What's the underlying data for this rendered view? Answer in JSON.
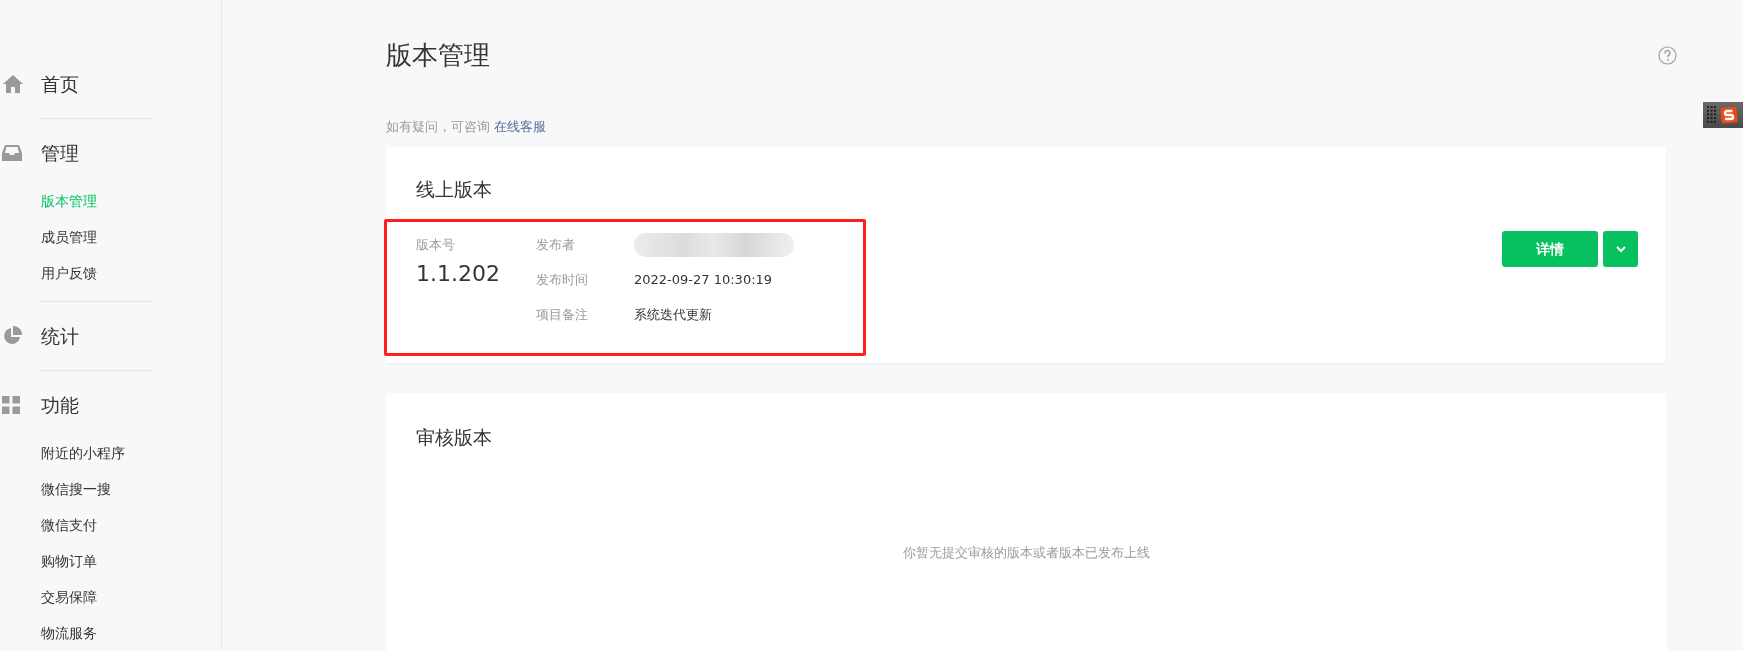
{
  "sidebar": {
    "sections": [
      {
        "label": "首页"
      },
      {
        "label": "管理",
        "items": [
          {
            "label": "版本管理",
            "selected": true
          },
          {
            "label": "成员管理",
            "selected": false
          },
          {
            "label": "用户反馈",
            "selected": false
          }
        ]
      },
      {
        "label": "统计"
      },
      {
        "label": "功能",
        "items": [
          {
            "label": "附近的小程序",
            "selected": false
          },
          {
            "label": "微信搜一搜",
            "selected": false
          },
          {
            "label": "微信支付",
            "selected": false
          },
          {
            "label": "购物订单",
            "selected": false
          },
          {
            "label": "交易保障",
            "selected": false
          },
          {
            "label": "物流服务",
            "selected": false
          }
        ]
      }
    ]
  },
  "page": {
    "title": "版本管理",
    "hint": "如有疑问，可咨询",
    "hint_link": "在线客服"
  },
  "online_version": {
    "title": "线上版本",
    "highlighted": true,
    "version_label": "版本号",
    "version": "1.1.202",
    "fields": [
      {
        "label": "发布者",
        "redacted": true
      },
      {
        "label": "发布时间",
        "value": "2022-09-27 10:30:19",
        "redacted": false
      },
      {
        "label": "项目备注",
        "value": "系统迭代更新",
        "redacted": false
      }
    ],
    "buttons": [
      "详情"
    ]
  },
  "review_version": {
    "title": "审核版本",
    "empty_text": "你暂无提交审核的版本或者版本已发布上线"
  }
}
